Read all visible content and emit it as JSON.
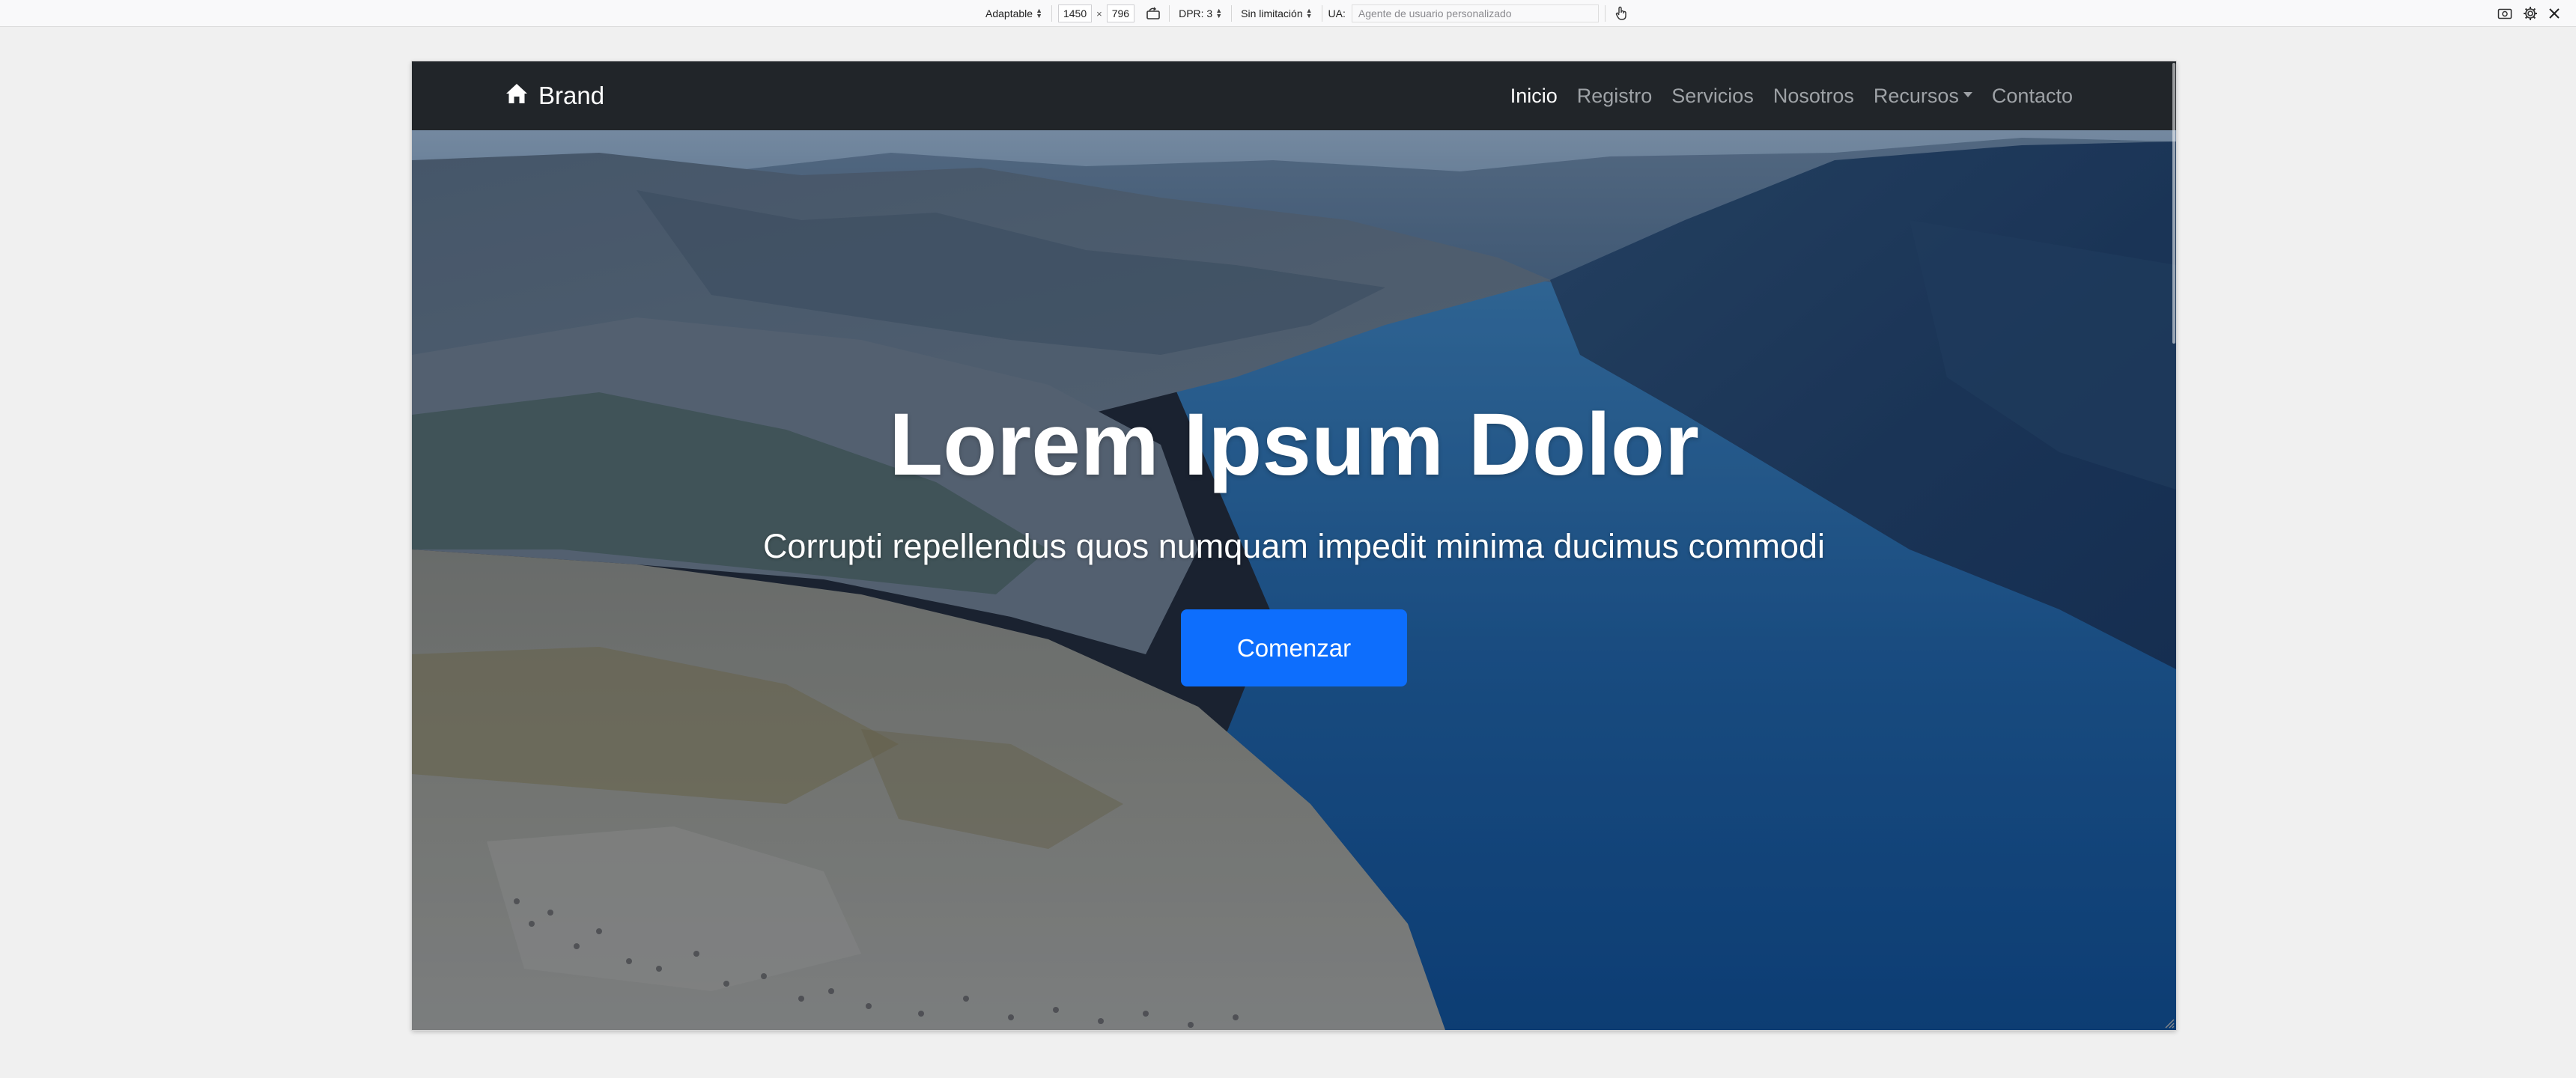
{
  "devtools": {
    "device_mode": "Adaptable",
    "width": "1450",
    "times": "×",
    "height": "796",
    "dpr": "DPR: 3",
    "throttling": "Sin limitación",
    "ua_label": "UA:",
    "ua_placeholder": "Agente de usuario personalizado",
    "icons": [
      "rotate-icon",
      "touch-icon",
      "screenshot-icon",
      "settings-icon",
      "close-icon"
    ]
  },
  "navbar": {
    "brand": "Brand",
    "brand_icon": "home-icon",
    "links": [
      {
        "label": "Inicio",
        "active": true
      },
      {
        "label": "Registro"
      },
      {
        "label": "Servicios"
      },
      {
        "label": "Nosotros"
      },
      {
        "label": "Recursos",
        "dropdown": true
      },
      {
        "label": "Contacto"
      }
    ]
  },
  "hero": {
    "title": "Lorem Ipsum Dolor",
    "subtitle": "Corrupti repellendus quos numquam impedit minima ducimus commodi",
    "cta": "Comenzar"
  },
  "colors": {
    "navbar_bg": "#212529",
    "primary": "#0d6efd",
    "nav_active": "#ffffff",
    "nav_muted": "#9ea2a6"
  }
}
